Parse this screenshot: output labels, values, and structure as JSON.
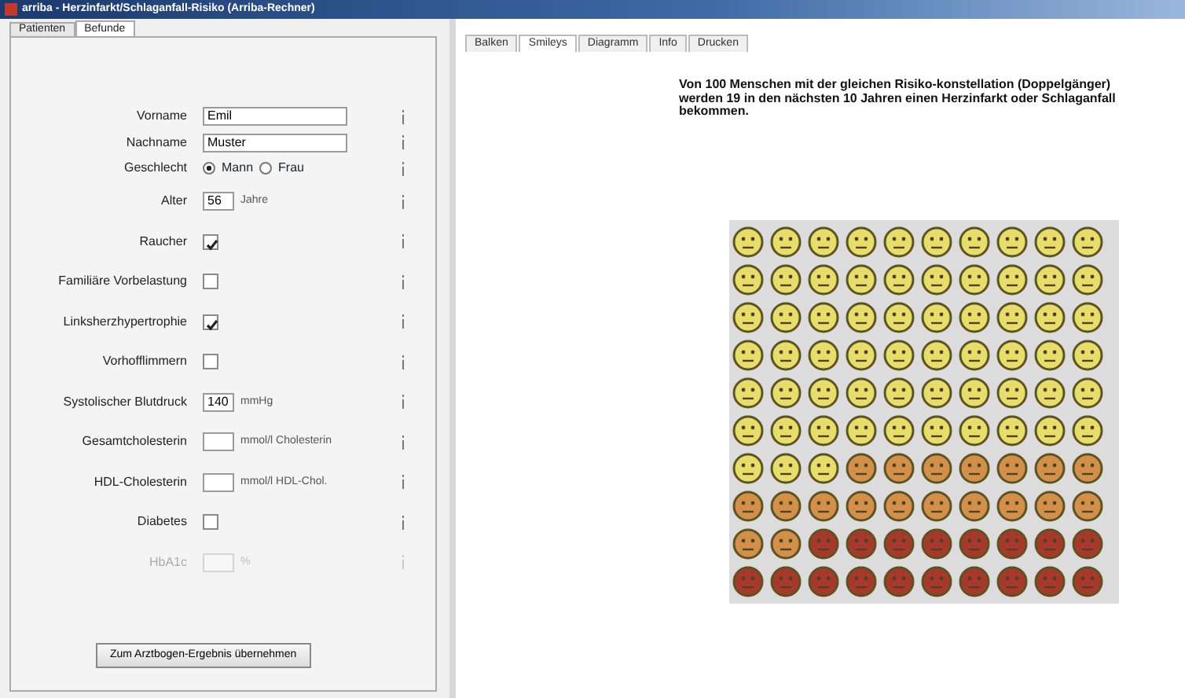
{
  "window": {
    "title": "arriba - Herzinfarkt/Schlaganfall-Risiko (Arriba-Rechner)"
  },
  "left_tabs": [
    {
      "label": "Patienten",
      "selected": false
    },
    {
      "label": "Befunde",
      "selected": true
    }
  ],
  "form": [
    {
      "kind": "text",
      "label": "Vorname",
      "value": "Emil",
      "disabled": false
    },
    {
      "kind": "text",
      "label": "Nachname",
      "value": "Muster",
      "disabled": false
    },
    {
      "kind": "radio",
      "label": "Geschlecht",
      "options": [
        {
          "label": "Mann",
          "selected": true
        },
        {
          "label": "Frau",
          "selected": false
        }
      ],
      "disabled": false
    },
    {
      "kind": "number",
      "label": "Alter",
      "value": "56",
      "unit": "Jahre",
      "disabled": false
    },
    {
      "kind": "checkbox",
      "label": "Raucher",
      "checked": true,
      "disabled": false
    },
    {
      "kind": "checkbox",
      "label": "Familiäre Vorbelastung",
      "checked": false,
      "disabled": false
    },
    {
      "kind": "checkbox",
      "label": "Linksherzhypertrophie",
      "checked": true,
      "disabled": false
    },
    {
      "kind": "checkbox",
      "label": "Vorhofflimmern",
      "checked": false,
      "disabled": false
    },
    {
      "kind": "number",
      "label": "Systolischer Blutdruck",
      "value": "140",
      "unit": "mmHg",
      "disabled": false
    },
    {
      "kind": "number",
      "label": "Gesamtcholesterin",
      "unit": "mmol/l Cholesterin",
      "disabled": false
    },
    {
      "kind": "number",
      "label": "HDL-Cholesterin",
      "unit": "mmol/l HDL-Chol.",
      "disabled": false
    },
    {
      "kind": "checkbox",
      "label": "Diabetes",
      "checked": false,
      "disabled": false
    },
    {
      "kind": "number",
      "label": "HbA1c",
      "unit": "%",
      "disabled": true
    }
  ],
  "action_button": {
    "label": "Zum Arztbogen-Ergebnis übernehmen"
  },
  "right_tabs": [
    {
      "label": "Balken",
      "selected": false
    },
    {
      "label": "Smileys",
      "selected": true
    },
    {
      "label": "Diagramm",
      "selected": false
    },
    {
      "label": "Info",
      "selected": false
    },
    {
      "label": "Drucken",
      "selected": false
    }
  ],
  "message": "Von 100 Menschen mit der gleichen Risiko-konstellation (Doppelgänger) werden 19 in den nächsten 10 Jahren einen Herzinfarkt oder Schlaganfall bekommen.",
  "smiley_rows": [
    {
      "cells": [
        {
          "color": "#e8dc6a"
        },
        {
          "color": "#e8dc6a"
        },
        {
          "color": "#e8dc6a"
        },
        {
          "color": "#e8dc6a"
        },
        {
          "color": "#e8dc6a"
        },
        {
          "color": "#e8dc6a"
        },
        {
          "color": "#e8dc6a"
        },
        {
          "color": "#e8dc6a"
        },
        {
          "color": "#e8dc6a"
        },
        {
          "color": "#e8dc6a"
        }
      ]
    },
    {
      "cells": [
        {
          "color": "#e8dc6a"
        },
        {
          "color": "#e8dc6a"
        },
        {
          "color": "#e8dc6a"
        },
        {
          "color": "#e8dc6a"
        },
        {
          "color": "#e8dc6a"
        },
        {
          "color": "#e8dc6a"
        },
        {
          "color": "#e8dc6a"
        },
        {
          "color": "#e8dc6a"
        },
        {
          "color": "#e8dc6a"
        },
        {
          "color": "#e8dc6a"
        }
      ]
    },
    {
      "cells": [
        {
          "color": "#e8dc6a"
        },
        {
          "color": "#e8dc6a"
        },
        {
          "color": "#e8dc6a"
        },
        {
          "color": "#e8dc6a"
        },
        {
          "color": "#e8dc6a"
        },
        {
          "color": "#e8dc6a"
        },
        {
          "color": "#e8dc6a"
        },
        {
          "color": "#e8dc6a"
        },
        {
          "color": "#e8dc6a"
        },
        {
          "color": "#e8dc6a"
        }
      ]
    },
    {
      "cells": [
        {
          "color": "#e8dc6a"
        },
        {
          "color": "#e8dc6a"
        },
        {
          "color": "#e8dc6a"
        },
        {
          "color": "#e8dc6a"
        },
        {
          "color": "#e8dc6a"
        },
        {
          "color": "#e8dc6a"
        },
        {
          "color": "#e8dc6a"
        },
        {
          "color": "#e8dc6a"
        },
        {
          "color": "#e8dc6a"
        },
        {
          "color": "#e8dc6a"
        }
      ]
    },
    {
      "cells": [
        {
          "color": "#e8dc6a"
        },
        {
          "color": "#e8dc6a"
        },
        {
          "color": "#e8dc6a"
        },
        {
          "color": "#e8dc6a"
        },
        {
          "color": "#e8dc6a"
        },
        {
          "color": "#e8dc6a"
        },
        {
          "color": "#e8dc6a"
        },
        {
          "color": "#e8dc6a"
        },
        {
          "color": "#e8dc6a"
        },
        {
          "color": "#e8dc6a"
        }
      ]
    },
    {
      "cells": [
        {
          "color": "#e8dc6a"
        },
        {
          "color": "#e8dc6a"
        },
        {
          "color": "#e8dc6a"
        },
        {
          "color": "#e8dc6a"
        },
        {
          "color": "#e8dc6a"
        },
        {
          "color": "#e8dc6a"
        },
        {
          "color": "#e8dc6a"
        },
        {
          "color": "#e8dc6a"
        },
        {
          "color": "#e8dc6a"
        },
        {
          "color": "#e8dc6a"
        }
      ]
    },
    {
      "cells": [
        {
          "color": "#e8dc6a"
        },
        {
          "color": "#e8dc6a"
        },
        {
          "color": "#e8dc6a"
        },
        {
          "color": "#d4904a"
        },
        {
          "color": "#d4904a"
        },
        {
          "color": "#d4904a"
        },
        {
          "color": "#d4904a"
        },
        {
          "color": "#d4904a"
        },
        {
          "color": "#d4904a"
        },
        {
          "color": "#d4904a"
        }
      ]
    },
    {
      "cells": [
        {
          "color": "#d4904a"
        },
        {
          "color": "#d4904a"
        },
        {
          "color": "#d4904a"
        },
        {
          "color": "#d4904a"
        },
        {
          "color": "#d4904a"
        },
        {
          "color": "#d4904a"
        },
        {
          "color": "#d4904a"
        },
        {
          "color": "#d4904a"
        },
        {
          "color": "#d4904a"
        },
        {
          "color": "#d4904a"
        }
      ]
    },
    {
      "cells": [
        {
          "color": "#d4904a"
        },
        {
          "color": "#d4904a"
        },
        {
          "color": "#a8382c"
        },
        {
          "color": "#a8382c"
        },
        {
          "color": "#a8382c"
        },
        {
          "color": "#a8382c"
        },
        {
          "color": "#a8382c"
        },
        {
          "color": "#a8382c"
        },
        {
          "color": "#a8382c"
        },
        {
          "color": "#a8382c"
        }
      ]
    },
    {
      "cells": [
        {
          "color": "#a8382c"
        },
        {
          "color": "#a8382c"
        },
        {
          "color": "#a8382c"
        },
        {
          "color": "#a8382c"
        },
        {
          "color": "#a8382c"
        },
        {
          "color": "#a8382c"
        },
        {
          "color": "#a8382c"
        },
        {
          "color": "#a8382c"
        },
        {
          "color": "#a8382c"
        },
        {
          "color": "#a8382c"
        }
      ]
    }
  ]
}
